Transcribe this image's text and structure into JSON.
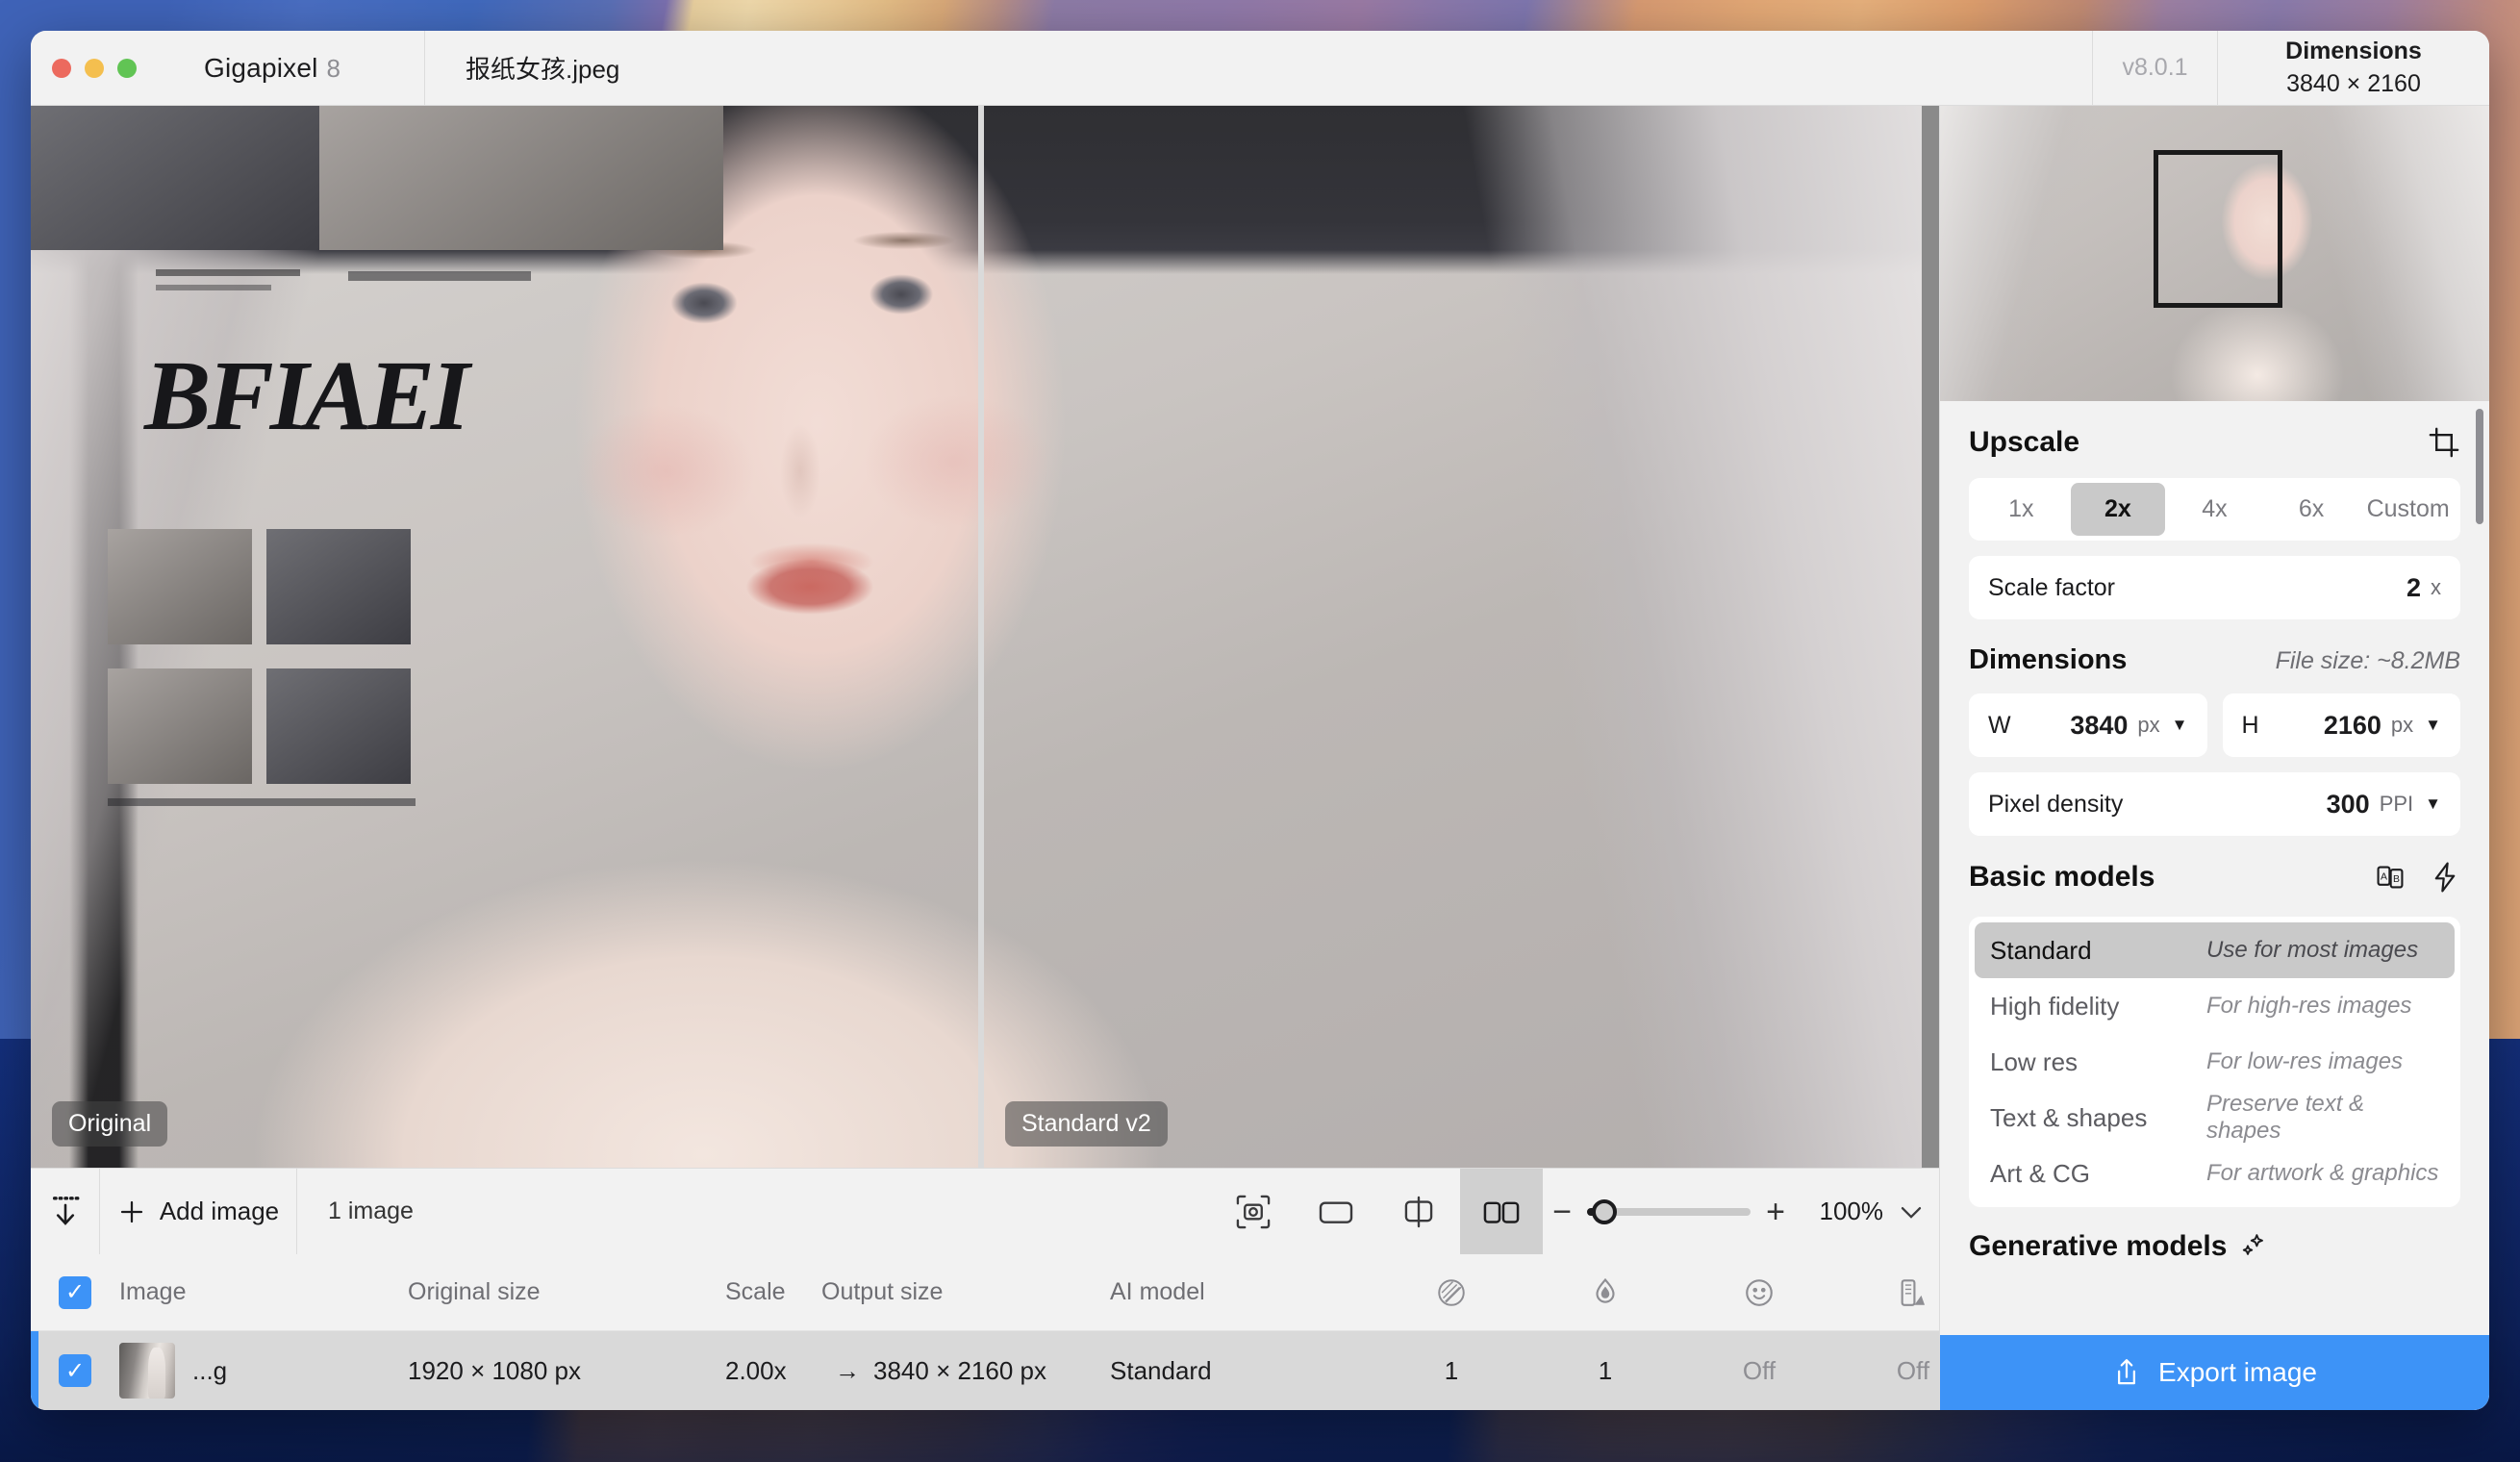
{
  "titlebar": {
    "app_name": "Gigapixel",
    "app_major": "8",
    "filename": "报纸女孩.jpeg",
    "version": "v8.0.1",
    "dimensions_label": "Dimensions",
    "dimensions_value": "3840 × 2160"
  },
  "viewer": {
    "left_label": "Original",
    "right_label": "Standard v2",
    "newspaper_word": "BFIAEI"
  },
  "toolbar": {
    "add_image_label": "Add image",
    "image_count": "1 image",
    "zoom_value": "100%",
    "view_modes": [
      {
        "name": "fit-to-screen-icon",
        "active": false
      },
      {
        "name": "single-view-icon",
        "active": false
      },
      {
        "name": "split-view-icon",
        "active": false
      },
      {
        "name": "side-by-side-view-icon",
        "active": true
      }
    ]
  },
  "table": {
    "headers": {
      "image": "Image",
      "original_size": "Original size",
      "scale": "Scale",
      "output_size": "Output size",
      "ai_model": "AI model",
      "icon_1": "sharpen-icon",
      "icon_2": "denoise-icon",
      "icon_3": "face-recovery-icon",
      "icon_4": "color-icon"
    },
    "rows": [
      {
        "name": "...g",
        "original_size": "1920 × 1080 px",
        "scale": "2.00x",
        "arrow": "→",
        "output_size": "3840 × 2160 px",
        "ai_model": "Standard",
        "val_1": "1",
        "val_2": "1",
        "val_3": "Off",
        "val_4": "Off",
        "checked": true
      }
    ]
  },
  "sidebar": {
    "upscale": {
      "title": "Upscale",
      "crop_icon": "crop-icon",
      "presets": [
        "1x",
        "2x",
        "4x",
        "6x",
        "Custom"
      ],
      "active_preset": "2x",
      "scale_factor_label": "Scale factor",
      "scale_factor_value": "2",
      "scale_factor_unit": "x"
    },
    "dimensions": {
      "title": "Dimensions",
      "file_size": "File size: ~8.2MB",
      "width_label": "W",
      "width_value": "3840",
      "width_unit": "px",
      "height_label": "H",
      "height_value": "2160",
      "height_unit": "px",
      "density_label": "Pixel density",
      "density_value": "300",
      "density_unit": "PPI"
    },
    "basic_models": {
      "title": "Basic models",
      "compare_icon": "ab-compare-icon",
      "flash_icon": "lightning-icon",
      "items": [
        {
          "name": "Standard",
          "desc": "Use for most images",
          "active": true
        },
        {
          "name": "High fidelity",
          "desc": "For high-res images",
          "active": false
        },
        {
          "name": "Low res",
          "desc": "For low-res images",
          "active": false
        },
        {
          "name": "Text & shapes",
          "desc": "Preserve text & shapes",
          "active": false
        },
        {
          "name": "Art & CG",
          "desc": "For artwork & graphics",
          "active": false
        }
      ]
    },
    "generative_models": {
      "title": "Generative models",
      "icon": "sparkles-icon"
    },
    "export": {
      "label": "Export image",
      "icon": "share-up-icon",
      "color": "#3d93f7"
    }
  }
}
